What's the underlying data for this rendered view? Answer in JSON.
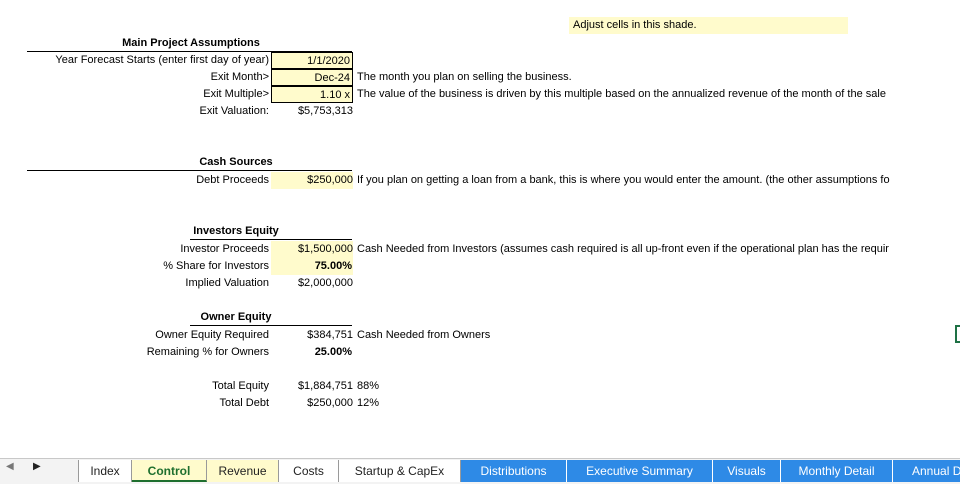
{
  "note": "Adjust cells in this shade.",
  "main": {
    "header": "Main Project Assumptions",
    "rows": [
      {
        "label": "Year Forecast Starts (enter first day of year)",
        "value": "1/1/2020",
        "comment": ""
      },
      {
        "label": "Exit Month>",
        "value": "Dec-24",
        "comment": "The month you plan on selling the business."
      },
      {
        "label": "Exit Multiple>",
        "value": "1.10 x",
        "comment": "The value of the business is driven by this multiple based on the annualized revenue of the month of the sale"
      },
      {
        "label": "Exit Valuation:",
        "value": "$5,753,313",
        "comment": ""
      }
    ]
  },
  "cash_sources": {
    "header": "Cash Sources",
    "rows": [
      {
        "label": "Debt Proceeds",
        "value": "$250,000",
        "comment": "If you plan on getting a loan from a bank, this is where you would enter the amount. (the other assumptions fo"
      }
    ]
  },
  "investors": {
    "header": "Investors Equity",
    "rows": [
      {
        "label": "Investor Proceeds",
        "value": "$1,500,000",
        "comment": "Cash Needed from Investors (assumes cash required is all up-front even if the operational plan has the requir"
      },
      {
        "label": "% Share for Investors",
        "value": "75.00%",
        "comment": ""
      },
      {
        "label": "Implied Valuation",
        "value": "$2,000,000",
        "comment": ""
      }
    ]
  },
  "owner": {
    "header": "Owner Equity",
    "rows": [
      {
        "label": "Owner Equity Required",
        "value": "$384,751",
        "comment": "Cash Needed from Owners"
      },
      {
        "label": "Remaining % for Owners",
        "value": "25.00%",
        "comment": ""
      }
    ]
  },
  "totals": {
    "rows": [
      {
        "label": "Total Equity",
        "value": "$1,884,751",
        "pct": "88%"
      },
      {
        "label": "Total Debt",
        "value": "$250,000",
        "pct": "12%"
      }
    ]
  },
  "tabs": {
    "nav_prev": "◀",
    "nav_next": "▶",
    "items": [
      "Index",
      "Control",
      "Revenue",
      "Costs",
      "Startup & CapEx",
      "Distributions",
      "Executive Summary",
      "Visuals",
      "Monthly Detail",
      "Annual D"
    ]
  },
  "colors": {
    "input_shade": "#fffbcc",
    "tab_blue": "#2e8ae6",
    "active_tab_text": "#1e6f2e"
  }
}
